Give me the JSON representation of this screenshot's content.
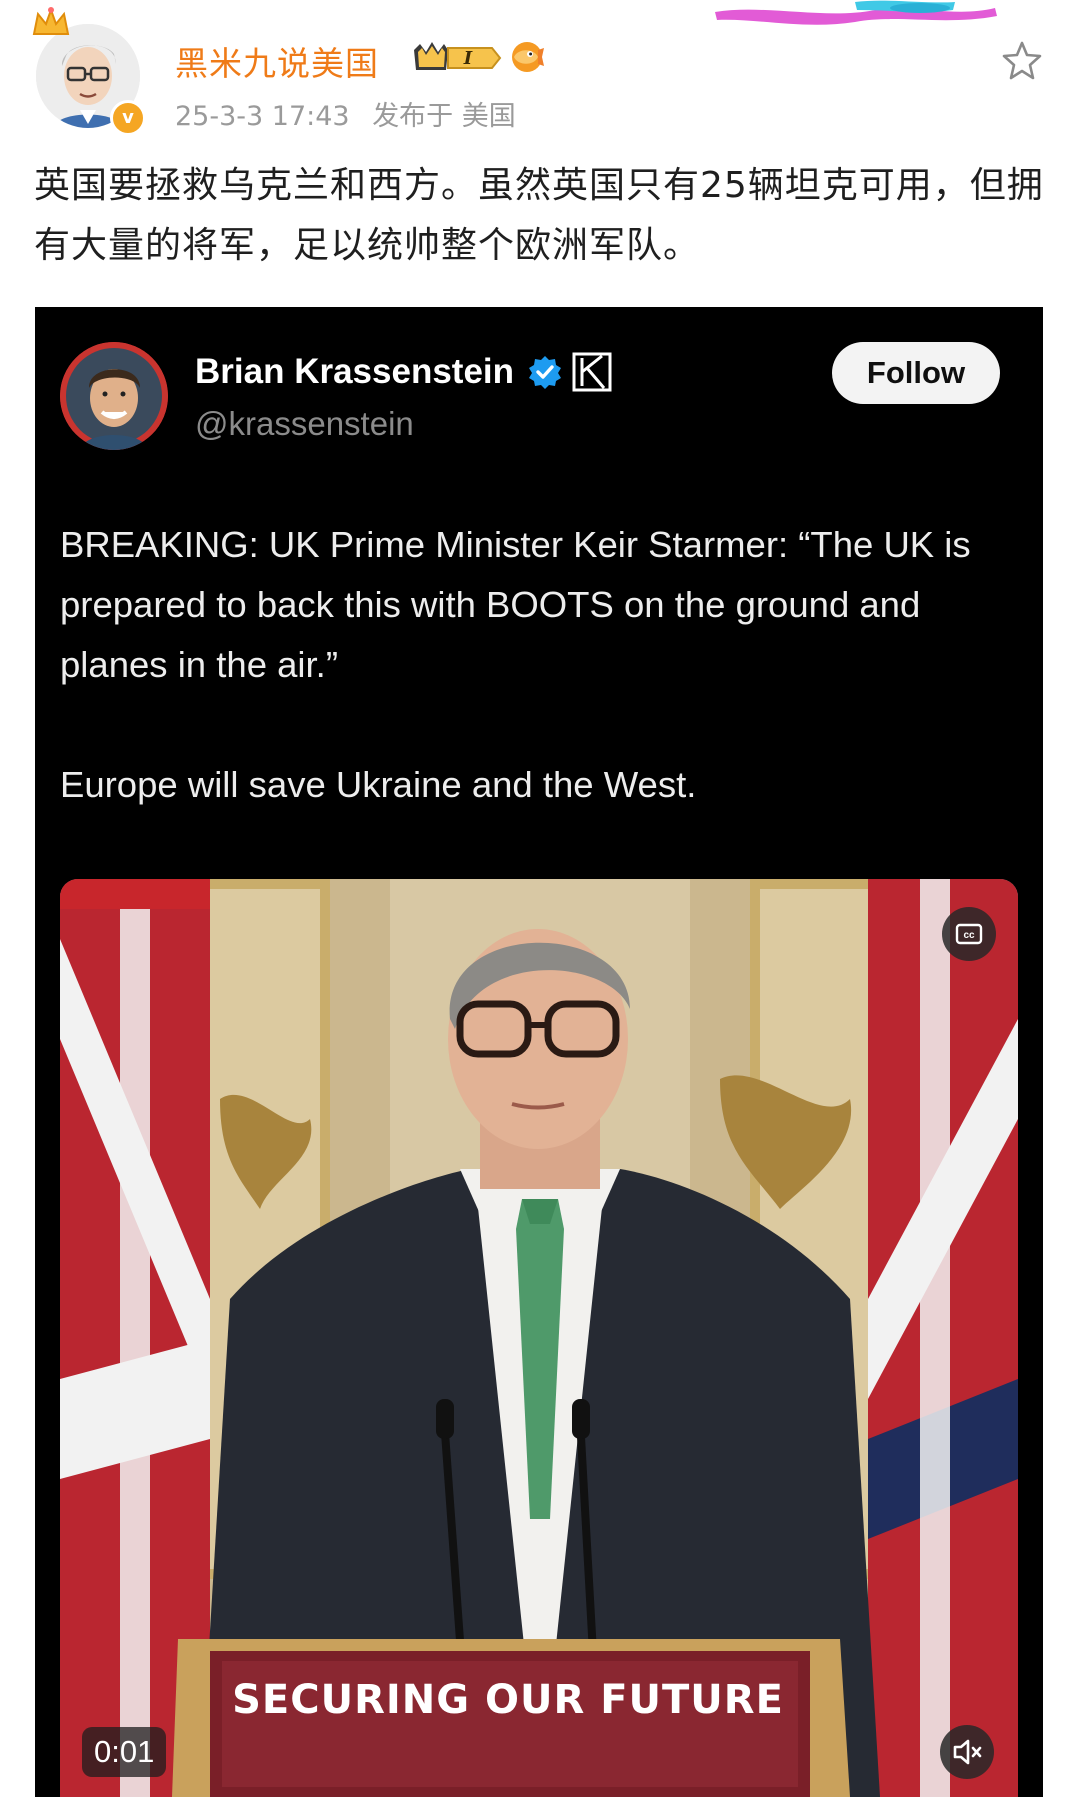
{
  "post": {
    "author": "黑米九说美国",
    "date": "25-3-3 17:43",
    "location": "发布于 美国",
    "vip_level": "I",
    "verified_mark": "v",
    "text": "英国要拯救乌克兰和西方。虽然英国只有25辆坦克可用，但拥有大量的将军，足以统帅整个欧洲军队。"
  },
  "tweet": {
    "name": "Brian Krassenstein",
    "handle": "@krassenstein",
    "follow_label": "Follow",
    "paragraphs": [
      "BREAKING: UK Prime Minister Keir Starmer: “The UK is prepared to back this with BOOTS on the ground and planes in the air.”",
      "Europe will save Ukraine and the West."
    ],
    "video": {
      "podium_text": "SECURING OUR FUTURE",
      "timestamp": "0:01",
      "cc_label": "cc"
    }
  },
  "colors": {
    "author_name": "#ef7b18",
    "meta_text": "#9a9a9a",
    "tweet_bg": "#000000",
    "twitter_verified": "#1d9bf0",
    "podium": "#7a1f28"
  },
  "icons": [
    "star-icon",
    "verified-badge-icon",
    "crown-icon",
    "vip-badge-icon",
    "fish-badge-icon",
    "twitter-verified-icon",
    "k-logo-icon",
    "closed-captions-icon",
    "mute-icon"
  ]
}
